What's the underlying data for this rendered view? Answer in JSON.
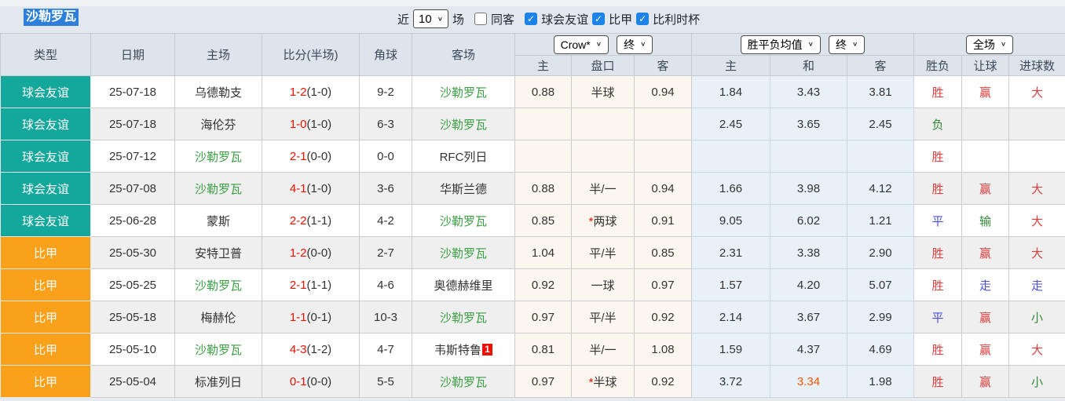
{
  "page_title": "沙勒罗瓦",
  "icons": {
    "chevron_down": "∨",
    "check": "✓"
  },
  "colors": {
    "page_bg": "#e7ebf0",
    "toolbar_bg": "#e3e8ee",
    "header_bg": "#dde4eb",
    "row_grey": "#efefef",
    "cream": "#fbf7ee",
    "pale_blue": "#e9f1f8",
    "teal": "#14a79b",
    "orange": "#f9a11b",
    "select_blue": "#2e7fd9",
    "check_blue": "#1e83e8",
    "score_red": "#ee1100",
    "team_green": "#3aa043",
    "res_red": "#dd4040",
    "res_green": "#2f8a35",
    "res_blue": "#4d4de0",
    "hl_orange": "#ff5500"
  },
  "toolbar": {
    "recent_label": "近",
    "count_value": "10",
    "matches_label": "场",
    "same_opponent": {
      "label": "同客",
      "checked": false
    },
    "filters": [
      {
        "label": "球会友谊",
        "checked": true
      },
      {
        "label": "比甲",
        "checked": true
      },
      {
        "label": "比利时杯",
        "checked": true
      }
    ]
  },
  "table": {
    "main_headers": [
      "类型",
      "日期",
      "主场",
      "比分(半场)",
      "角球",
      "客场"
    ],
    "dropdowns": {
      "company": "Crow*",
      "company_state": "终",
      "avg": "胜平负均值",
      "avg_state": "终",
      "scope": "全场"
    },
    "sub_headers": [
      "主",
      "盘口",
      "客",
      "主",
      "和",
      "客",
      "胜负",
      "让球",
      "进球数"
    ],
    "rows": [
      {
        "type": "球会友谊",
        "type_color": "teal",
        "date": "25-07-18",
        "home": {
          "name": "乌德勒支",
          "color": "dark"
        },
        "score_ft": "1-2",
        "score_ht": "(1-0)",
        "corner": "9-2",
        "away": {
          "name": "沙勒罗瓦",
          "color": "tgreen"
        },
        "away_sup": "",
        "crow_home": "0.88",
        "handicap_star": "",
        "handicap": "半球",
        "crow_away": "0.94",
        "avg_home": "1.84",
        "avg_draw": "3.43",
        "avg_draw_color": "dark",
        "avg_away": "3.81",
        "result": {
          "t": "胜",
          "c": "red"
        },
        "let_result": {
          "t": "赢",
          "c": "red"
        },
        "goal_result": {
          "t": "大",
          "c": "red"
        }
      },
      {
        "type": "球会友谊",
        "type_color": "teal",
        "date": "25-07-18",
        "home": {
          "name": "海伦芬",
          "color": "dark"
        },
        "score_ft": "1-0",
        "score_ht": "(1-0)",
        "corner": "6-3",
        "away": {
          "name": "沙勒罗瓦",
          "color": "tgreen"
        },
        "away_sup": "",
        "crow_home": "",
        "handicap_star": "",
        "handicap": "",
        "crow_away": "",
        "avg_home": "2.45",
        "avg_draw": "3.65",
        "avg_draw_color": "dark",
        "avg_away": "2.45",
        "result": {
          "t": "负",
          "c": "green"
        },
        "let_result": {
          "t": "",
          "c": ""
        },
        "goal_result": {
          "t": "",
          "c": ""
        }
      },
      {
        "type": "球会友谊",
        "type_color": "teal",
        "date": "25-07-12",
        "home": {
          "name": "沙勒罗瓦",
          "color": "tgreen"
        },
        "score_ft": "2-1",
        "score_ht": "(0-0)",
        "corner": "0-0",
        "away": {
          "name": "RFC列日",
          "color": "dark"
        },
        "away_sup": "",
        "crow_home": "",
        "handicap_star": "",
        "handicap": "",
        "crow_away": "",
        "avg_home": "",
        "avg_draw": "",
        "avg_draw_color": "dark",
        "avg_away": "",
        "result": {
          "t": "胜",
          "c": "red"
        },
        "let_result": {
          "t": "",
          "c": ""
        },
        "goal_result": {
          "t": "",
          "c": ""
        }
      },
      {
        "type": "球会友谊",
        "type_color": "teal",
        "date": "25-07-08",
        "home": {
          "name": "沙勒罗瓦",
          "color": "tgreen"
        },
        "score_ft": "4-1",
        "score_ht": "(1-0)",
        "corner": "3-6",
        "away": {
          "name": "华斯兰德",
          "color": "dark"
        },
        "away_sup": "",
        "crow_home": "0.88",
        "handicap_star": "",
        "handicap": "半/一",
        "crow_away": "0.94",
        "avg_home": "1.66",
        "avg_draw": "3.98",
        "avg_draw_color": "dark",
        "avg_away": "4.12",
        "result": {
          "t": "胜",
          "c": "red"
        },
        "let_result": {
          "t": "赢",
          "c": "red"
        },
        "goal_result": {
          "t": "大",
          "c": "red"
        }
      },
      {
        "type": "球会友谊",
        "type_color": "teal",
        "date": "25-06-28",
        "home": {
          "name": "蒙斯",
          "color": "dark"
        },
        "score_ft": "2-2",
        "score_ht": "(1-1)",
        "corner": "4-2",
        "away": {
          "name": "沙勒罗瓦",
          "color": "tgreen"
        },
        "away_sup": "",
        "crow_home": "0.85",
        "handicap_star": "*",
        "handicap": "两球",
        "crow_away": "0.91",
        "avg_home": "9.05",
        "avg_draw": "6.02",
        "avg_draw_color": "dark",
        "avg_away": "1.21",
        "result": {
          "t": "平",
          "c": "blue"
        },
        "let_result": {
          "t": "输",
          "c": "green"
        },
        "goal_result": {
          "t": "大",
          "c": "red"
        }
      },
      {
        "type": "比甲",
        "type_color": "orange",
        "date": "25-05-30",
        "home": {
          "name": "安特卫普",
          "color": "dark"
        },
        "score_ft": "1-2",
        "score_ht": "(0-0)",
        "corner": "2-7",
        "away": {
          "name": "沙勒罗瓦",
          "color": "tgreen"
        },
        "away_sup": "",
        "crow_home": "1.04",
        "handicap_star": "",
        "handicap": "平/半",
        "crow_away": "0.85",
        "avg_home": "2.31",
        "avg_draw": "3.38",
        "avg_draw_color": "dark",
        "avg_away": "2.90",
        "result": {
          "t": "胜",
          "c": "red"
        },
        "let_result": {
          "t": "赢",
          "c": "red"
        },
        "goal_result": {
          "t": "大",
          "c": "red"
        }
      },
      {
        "type": "比甲",
        "type_color": "orange",
        "date": "25-05-25",
        "home": {
          "name": "沙勒罗瓦",
          "color": "tgreen"
        },
        "score_ft": "2-1",
        "score_ht": "(1-1)",
        "corner": "4-6",
        "away": {
          "name": "奥德赫维里",
          "color": "dark"
        },
        "away_sup": "",
        "crow_home": "0.92",
        "handicap_star": "",
        "handicap": "一球",
        "crow_away": "0.97",
        "avg_home": "1.57",
        "avg_draw": "4.20",
        "avg_draw_color": "dark",
        "avg_away": "5.07",
        "result": {
          "t": "胜",
          "c": "red"
        },
        "let_result": {
          "t": "走",
          "c": "blue"
        },
        "goal_result": {
          "t": "走",
          "c": "blue"
        }
      },
      {
        "type": "比甲",
        "type_color": "orange",
        "date": "25-05-18",
        "home": {
          "name": "梅赫伦",
          "color": "dark"
        },
        "score_ft": "1-1",
        "score_ht": "(0-1)",
        "corner": "10-3",
        "away": {
          "name": "沙勒罗瓦",
          "color": "tgreen"
        },
        "away_sup": "",
        "crow_home": "0.97",
        "handicap_star": "",
        "handicap": "平/半",
        "crow_away": "0.92",
        "avg_home": "2.14",
        "avg_draw": "3.67",
        "avg_draw_color": "dark",
        "avg_away": "2.99",
        "result": {
          "t": "平",
          "c": "blue"
        },
        "let_result": {
          "t": "赢",
          "c": "red"
        },
        "goal_result": {
          "t": "小",
          "c": "green"
        }
      },
      {
        "type": "比甲",
        "type_color": "orange",
        "date": "25-05-10",
        "home": {
          "name": "沙勒罗瓦",
          "color": "tgreen"
        },
        "score_ft": "4-3",
        "score_ht": "(1-2)",
        "corner": "4-7",
        "away": {
          "name": "韦斯特鲁",
          "color": "dark"
        },
        "away_sup": "1",
        "crow_home": "0.81",
        "handicap_star": "",
        "handicap": "半/一",
        "crow_away": "1.08",
        "avg_home": "1.59",
        "avg_draw": "4.37",
        "avg_draw_color": "dark",
        "avg_away": "4.69",
        "result": {
          "t": "胜",
          "c": "red"
        },
        "let_result": {
          "t": "赢",
          "c": "red"
        },
        "goal_result": {
          "t": "大",
          "c": "red"
        }
      },
      {
        "type": "比甲",
        "type_color": "orange",
        "date": "25-05-04",
        "home": {
          "name": "标准列日",
          "color": "dark"
        },
        "score_ft": "0-1",
        "score_ht": "(0-0)",
        "corner": "5-5",
        "away": {
          "name": "沙勒罗瓦",
          "color": "tgreen"
        },
        "away_sup": "",
        "crow_home": "0.97",
        "handicap_star": "*",
        "handicap": "半球",
        "crow_away": "0.92",
        "avg_home": "3.72",
        "avg_draw": "3.34",
        "avg_draw_color": "orange",
        "avg_away": "1.98",
        "result": {
          "t": "胜",
          "c": "red"
        },
        "let_result": {
          "t": "赢",
          "c": "red"
        },
        "goal_result": {
          "t": "小",
          "c": "green"
        }
      }
    ]
  }
}
